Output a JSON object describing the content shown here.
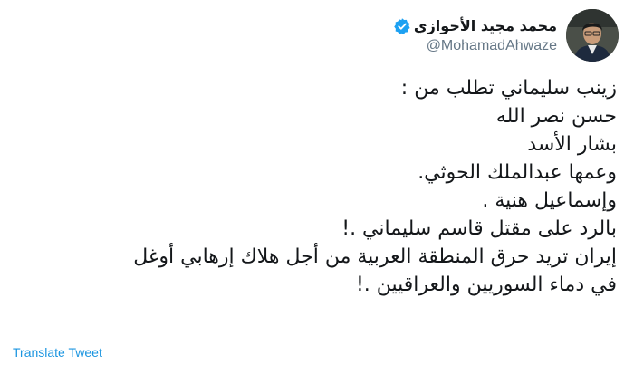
{
  "author": {
    "display_name": "محمد مجيد الأحوازي",
    "handle": "@MohamadAhwaze",
    "verified": true,
    "avatar": "profile-photo"
  },
  "tweet": {
    "lines": [
      "زينب سليماني تطلب من :",
      "حسن نصر الله",
      "بشار الأسد",
      "وعمها عبدالملك الحوثي.",
      "وإسماعيل هنية .",
      "بالرد على مقتل قاسم سليماني .!",
      "إيران تريد حرق المنطقة العربية من أجل هلاك إرهابي أوغل",
      "في دماء السوريين والعراقيين .!"
    ]
  },
  "actions": {
    "translate_label": "Translate Tweet"
  },
  "icons": {
    "menu": "chevron-down-icon",
    "verified": "verified-badge-icon"
  },
  "colors": {
    "accent": "#1da1f2",
    "link": "#1b95e0",
    "text": "#14171a",
    "secondary_text": "#657786"
  }
}
